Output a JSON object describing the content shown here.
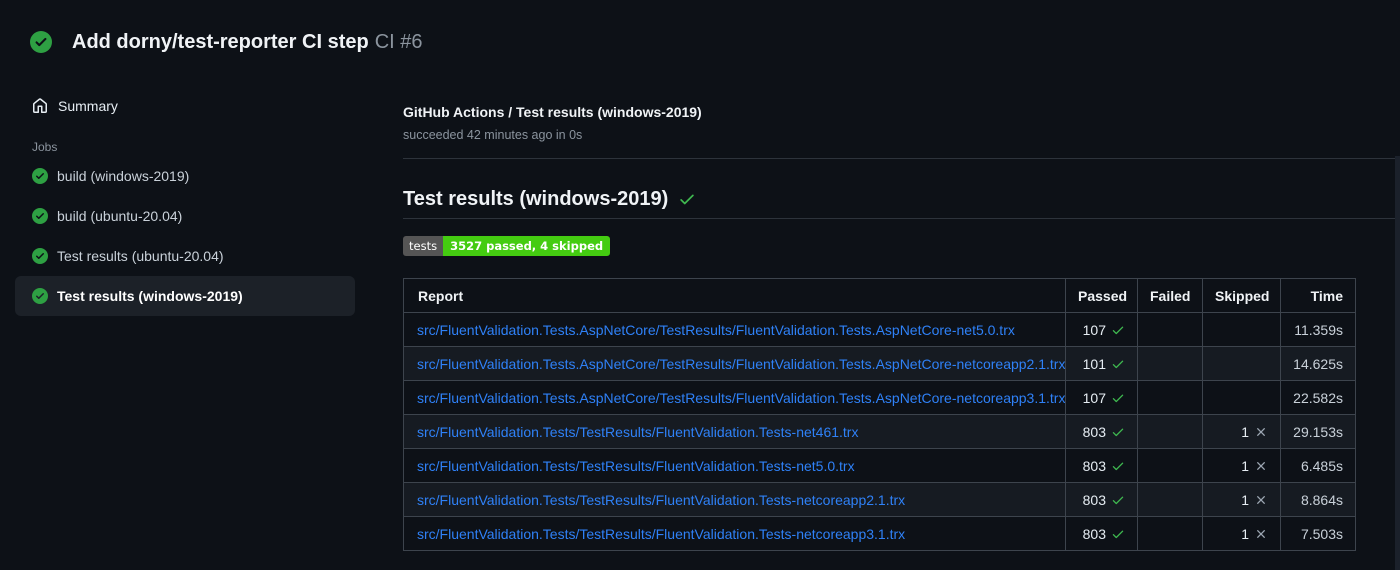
{
  "header": {
    "title": "Add dorny/test-reporter CI step",
    "run_number": "CI #6",
    "status_icon": "check-circle-icon"
  },
  "sidebar": {
    "summary_label": "Summary",
    "summary_icon": "home-icon",
    "jobs_label": "Jobs",
    "jobs": [
      {
        "label": "build (windows-2019)",
        "selected": false,
        "icon": "check-circle-icon"
      },
      {
        "label": "build (ubuntu-20.04)",
        "selected": false,
        "icon": "check-circle-icon"
      },
      {
        "label": "Test results (ubuntu-20.04)",
        "selected": false,
        "icon": "check-circle-icon"
      },
      {
        "label": "Test results (windows-2019)",
        "selected": true,
        "icon": "check-circle-icon"
      }
    ]
  },
  "check_run": {
    "title": "GitHub Actions / Test results (windows-2019)",
    "status": "succeeded 42 minutes ago in 0s",
    "heading": "Test results (windows-2019)",
    "heading_icon": "check-icon"
  },
  "badge": {
    "label": "tests",
    "value": "3527 passed, 4 skipped",
    "label_bg": "#555555",
    "value_bg": "#44cc11"
  },
  "table": {
    "columns": [
      "Report",
      "Passed",
      "Failed",
      "Skipped",
      "Time"
    ],
    "rows": [
      {
        "report": "src/FluentValidation.Tests.AspNetCore/TestResults/FluentValidation.Tests.AspNetCore-net5.0.trx",
        "passed": "107",
        "failed": "",
        "skipped": "",
        "time": "11.359s"
      },
      {
        "report": "src/FluentValidation.Tests.AspNetCore/TestResults/FluentValidation.Tests.AspNetCore-netcoreapp2.1.trx",
        "passed": "101",
        "failed": "",
        "skipped": "",
        "time": "14.625s"
      },
      {
        "report": "src/FluentValidation.Tests.AspNetCore/TestResults/FluentValidation.Tests.AspNetCore-netcoreapp3.1.trx",
        "passed": "107",
        "failed": "",
        "skipped": "",
        "time": "22.582s"
      },
      {
        "report": "src/FluentValidation.Tests/TestResults/FluentValidation.Tests-net461.trx",
        "passed": "803",
        "failed": "",
        "skipped": "1",
        "time": "29.153s"
      },
      {
        "report": "src/FluentValidation.Tests/TestResults/FluentValidation.Tests-net5.0.trx",
        "passed": "803",
        "failed": "",
        "skipped": "1",
        "time": "6.485s"
      },
      {
        "report": "src/FluentValidation.Tests/TestResults/FluentValidation.Tests-netcoreapp2.1.trx",
        "passed": "803",
        "failed": "",
        "skipped": "1",
        "time": "8.864s"
      },
      {
        "report": "src/FluentValidation.Tests/TestResults/FluentValidation.Tests-netcoreapp3.1.trx",
        "passed": "803",
        "failed": "",
        "skipped": "1",
        "time": "7.503s"
      }
    ],
    "passed_icon": "check-icon",
    "skipped_icon": "x-icon"
  },
  "colors": {
    "background": "#0d1117",
    "success_green": "#2ea043",
    "check_green": "#3fb950",
    "link_blue": "#2f81f7",
    "muted_gray": "#8b949e",
    "border": "#3d444d",
    "x_gray": "#9da7b3"
  }
}
